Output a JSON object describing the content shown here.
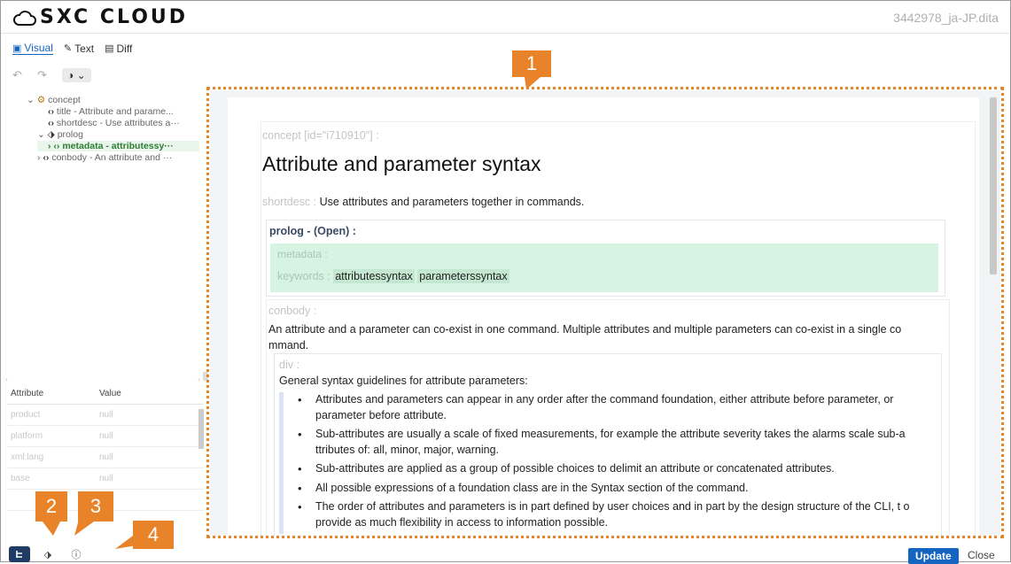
{
  "header": {
    "brand": "SXC CLOUD",
    "filename": "3442978_ja-JP.dita"
  },
  "view_tabs": [
    {
      "label": "Visual",
      "icon": "visual-icon",
      "active": true
    },
    {
      "label": "Text",
      "icon": "pen-icon",
      "active": false
    },
    {
      "label": "Diff",
      "icon": "diff-icon",
      "active": false
    }
  ],
  "toolbar": {
    "undo": "↶",
    "redo": "↷",
    "contrast": "◑ ⌄"
  },
  "tree": {
    "root": "concept",
    "items": [
      {
        "tag": "title",
        "text": "- Attribute and parame..."
      },
      {
        "tag": "shortdesc",
        "text": "- Use attributes a···"
      },
      {
        "tag": "prolog",
        "text": ""
      },
      {
        "tag": "metadata",
        "text": "- attributessy···"
      },
      {
        "tag": "conbody",
        "text": "- An attribute and ···"
      }
    ]
  },
  "attributes": {
    "col_attribute": "Attribute",
    "col_value": "Value",
    "rows": [
      {
        "name": "product",
        "value": "null"
      },
      {
        "name": "platform",
        "value": "null"
      },
      {
        "name": "xml:lang",
        "value": "null"
      },
      {
        "name": "base",
        "value": "null"
      }
    ]
  },
  "doc": {
    "concept_label": "concept [id=\"i710910\"] :",
    "title": "Attribute and parameter syntax",
    "shortdesc_label": "shortdesc :",
    "shortdesc": "Use attributes and parameters together in commands.",
    "prolog_label": "prolog - (Open) :",
    "metadata_label": "metadata :",
    "keywords_label": "keywords :",
    "keywords": [
      "attributessyntax",
      "parameterssyntax"
    ],
    "conbody_label": "conbody :",
    "conbody_text": "An attribute and a parameter can co-exist in one command. Multiple attributes and multiple parameters can co-exist in a single co mmand.",
    "div_label": "div :",
    "div_text": "General syntax guidelines for attribute parameters:",
    "bullets": [
      "Attributes and parameters can appear in any order after the command foundation, either attribute before parameter, or parameter before attribute.",
      "Sub-attributes are usually a scale of fixed measurements, for example the attribute severity takes the alarms scale sub-a ttributes of: all, minor, major, warning.",
      "Sub-attributes are applied as a group of possible choices to delimit an attribute or concatenated attributes.",
      "All possible expressions of a foundation class are in the Syntax section of the command.",
      "The order of attributes and parameters is in part defined by user choices and in part by the design structure of the CLI, t o provide as much flexibility in access to information possible."
    ]
  },
  "footer": {
    "update": "Update",
    "close": "Close"
  },
  "callouts": [
    "1",
    "2",
    "3",
    "4"
  ],
  "colors": {
    "accent": "#1565c0",
    "callout": "#e8832a",
    "metadata_bg": "#d7f4e3"
  }
}
